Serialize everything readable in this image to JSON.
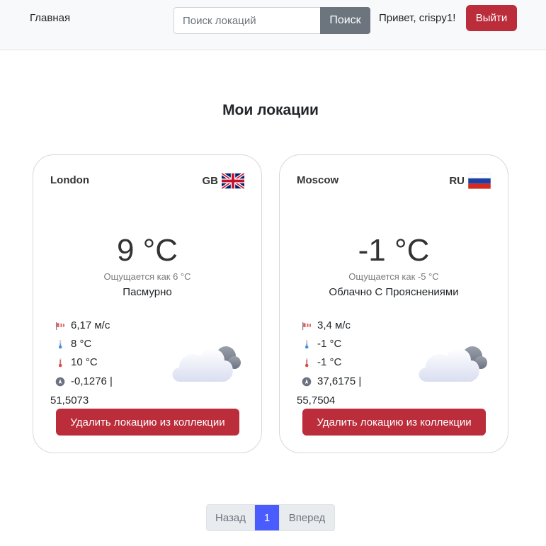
{
  "nav": {
    "home": "Главная",
    "search_placeholder": "Поиск локаций",
    "search_button": "Поиск",
    "greeting": "Привет, crispy1!",
    "logout": "Выйти"
  },
  "page_title": "Мои локации",
  "cards": [
    {
      "name": "London",
      "country": "GB",
      "flag": "uk-flag",
      "temp": "9 °C",
      "feels": "Ощущается как 6 °C",
      "description": "Пасмурно",
      "wind": "6,17 м/с",
      "temp_min": "8 °C",
      "temp_max": "10 °C",
      "coord_line1": "-0,1276 |",
      "coord_line2": "51,5073",
      "weather_icon": "cloudy-icon",
      "remove": "Удалить локацию из коллекции"
    },
    {
      "name": "Moscow",
      "country": "RU",
      "flag": "russia-flag",
      "temp": "-1 °C",
      "feels": "Ощущается как -5 °C",
      "description": "Облачно С Прояснениями",
      "wind": "3,4 м/с",
      "temp_min": "-1 °C",
      "temp_max": "-1 °C",
      "coord_line1": "37,6175 |",
      "coord_line2": "55,7504",
      "weather_icon": "cloudy-icon",
      "remove": "Удалить локацию из коллекции"
    }
  ],
  "pagination": {
    "prev": "Назад",
    "current": "1",
    "next": "Вперед"
  },
  "colors": {
    "danger": "#bb2d3b",
    "secondary": "#6c757d",
    "active_page": "#4b5cff"
  }
}
